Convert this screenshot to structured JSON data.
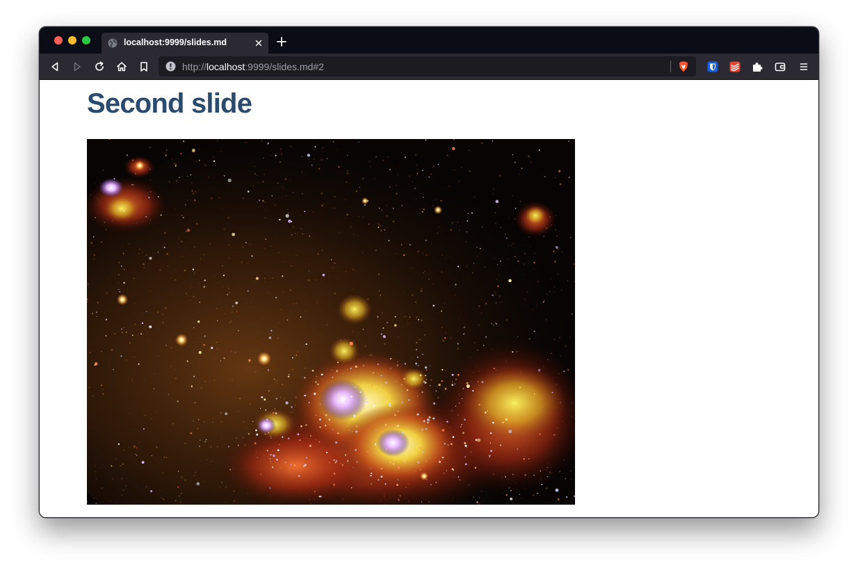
{
  "browser": {
    "tab": {
      "title": "localhost:9999/slides.md"
    },
    "url": {
      "scheme": "http://",
      "host": "localhost",
      "rest": ":9999/slides.md#2"
    },
    "icons": {
      "favicon": "globe-icon",
      "tab_close": "close-icon",
      "new_tab": "plus-icon",
      "back": "back-arrow-icon",
      "forward": "forward-arrow-icon",
      "reload": "reload-icon",
      "home": "home-icon",
      "bookmark": "bookmark-icon",
      "site_info": "info-icon",
      "brave": "brave-shield-icon",
      "bitwarden": "bitwarden-icon",
      "todoist": "todoist-icon",
      "extensions": "puzzle-icon",
      "wallet": "wallet-icon",
      "menu": "hamburger-menu-icon"
    },
    "colors": {
      "tabbar": "#0c0c16",
      "toolbar": "#2b2a33",
      "urlbar": "#1c1b22"
    }
  },
  "slide": {
    "title": "Second slide",
    "title_color": "#2a4a6e",
    "image": {
      "kind": "astronomical-photo",
      "description_shown": "galaxy-nebula-image"
    }
  }
}
